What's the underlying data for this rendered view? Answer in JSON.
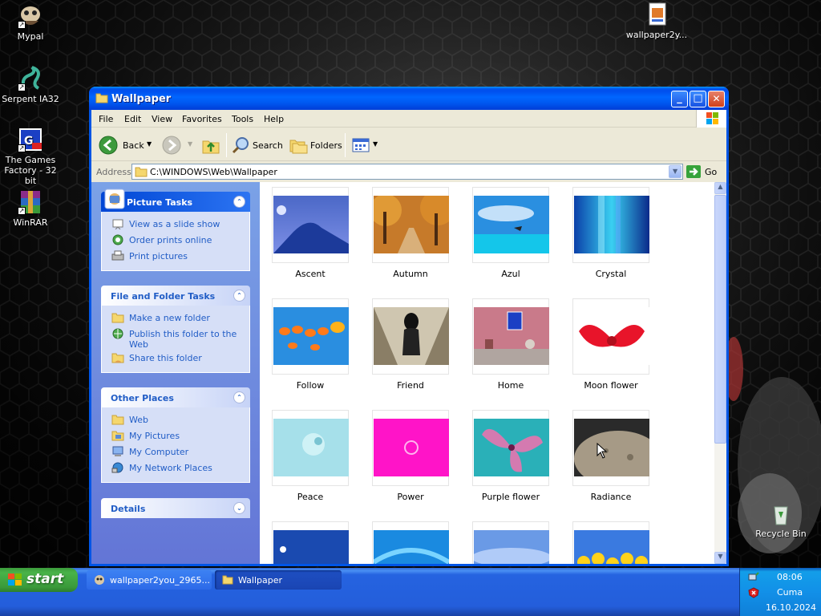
{
  "desktop": {
    "icons": [
      {
        "label": "Mypal",
        "icon": "mypal-icon"
      },
      {
        "label": "Serpent IA32",
        "icon": "serpent-icon"
      },
      {
        "label": "The Games Factory - 32 bit",
        "icon": "games-factory-icon"
      },
      {
        "label": "WinRAR",
        "icon": "winrar-icon"
      },
      {
        "label": "wallpaper2y...",
        "icon": "html-file-icon"
      },
      {
        "label": "Recycle Bin",
        "icon": "recycle-bin-icon"
      }
    ]
  },
  "window": {
    "title": "Wallpaper",
    "buttons": {
      "minimize": "_",
      "maximize": "□",
      "close": "✕"
    }
  },
  "menu": [
    "File",
    "Edit",
    "View",
    "Favorites",
    "Tools",
    "Help"
  ],
  "toolbar": {
    "back": "Back",
    "search": "Search",
    "folders": "Folders"
  },
  "address": {
    "label": "Address",
    "value": "C:\\WINDOWS\\Web\\Wallpaper",
    "go": "Go"
  },
  "taskpane": {
    "picture_tasks": {
      "title": "Picture Tasks",
      "items": [
        "View as a slide show",
        "Order prints online",
        "Print pictures"
      ]
    },
    "file_folder_tasks": {
      "title": "File and Folder Tasks",
      "items": [
        "Make a new folder",
        "Publish this folder to the Web",
        "Share this folder"
      ]
    },
    "other_places": {
      "title": "Other Places",
      "items": [
        "Web",
        "My Pictures",
        "My Computer",
        "My Network Places"
      ]
    },
    "details": {
      "title": "Details"
    }
  },
  "files": [
    {
      "name": "Ascent"
    },
    {
      "name": "Autumn"
    },
    {
      "name": "Azul"
    },
    {
      "name": "Crystal"
    },
    {
      "name": "Follow"
    },
    {
      "name": "Friend"
    },
    {
      "name": "Home"
    },
    {
      "name": "Moon flower"
    },
    {
      "name": "Peace"
    },
    {
      "name": "Power"
    },
    {
      "name": "Purple flower"
    },
    {
      "name": "Radiance"
    }
  ],
  "taskbar": {
    "start": "start",
    "items": [
      "wallpaper2you_2965...",
      "Wallpaper"
    ],
    "clock": {
      "time": "08:06",
      "day": "Cuma",
      "date": "16.10.2024"
    }
  },
  "colors": {
    "xp_blue": "#0054e3",
    "taskpane_link": "#215dc6",
    "start_green": "#3a9a3a"
  }
}
